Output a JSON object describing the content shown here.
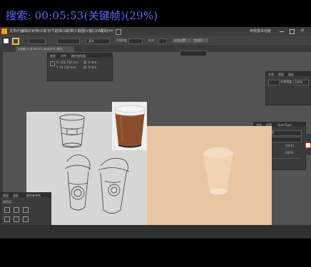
{
  "overlay": {
    "text": "搜索: 00:05:53(关键帧)(29%)",
    "color": "#5a6bff"
  },
  "menubar": {
    "items": [
      "文件(F)",
      "编辑(E)",
      "对象(O)",
      "文字(T)",
      "选择(S)",
      "效果(C)",
      "视图(V)",
      "窗口(W)",
      "帮助(H)"
    ],
    "workspace": "传统基本功能"
  },
  "options": {
    "stroke_profile": "基本",
    "opacity_label": "不透明度",
    "style_label": "样式",
    "doc_setup": "文档设置",
    "prefs": "首选项"
  },
  "document_tab": {
    "title": "未标题-1* @ 66.67% (RGB/GPU 预览)"
  },
  "transform_panel": {
    "tabs": [
      "变换",
      "对齐",
      "路径查找器"
    ],
    "x": "X: 161.734 mm",
    "y": "Y: 41.133 mm",
    "w": "宽: 0 mm",
    "h": "高: 0 mm"
  },
  "appearance_panel": {
    "tabs": [
      "外观",
      "图层",
      "画板"
    ],
    "opacity_label": "不透明度",
    "opacity_value": "100%"
  },
  "character_panel": {
    "tabs": [
      "字符",
      "段落",
      "OpenType"
    ],
    "font": "微软雅黑",
    "style": "Bold",
    "size": "12 pt",
    "leading": "(14.4)",
    "scale_h": "100%",
    "scale_v": "100%"
  },
  "layers_panel": {
    "tabs": [
      "图层",
      "画板",
      "颜色参考线"
    ],
    "label": "颜色组"
  },
  "colors": {
    "peach": "#e8c6a2",
    "overlay": "#5a6bff",
    "cup_brown": "#8a4f2a"
  },
  "icons": [
    "sketch-image",
    "coffee-cup-photo",
    "plastic-cup-icon",
    "grid-icon",
    "close-icon"
  ]
}
